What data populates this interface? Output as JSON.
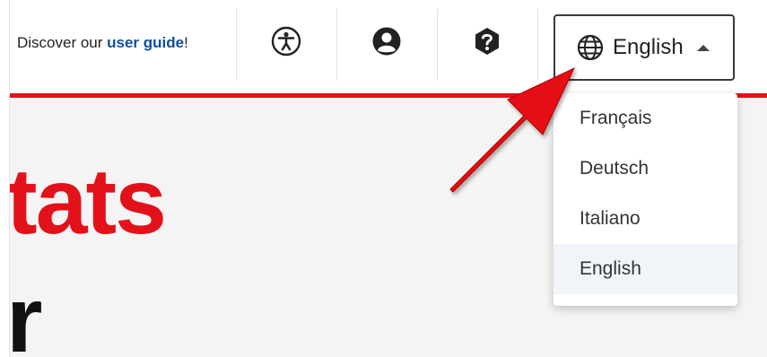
{
  "header": {
    "guide_prefix": "Discover our ",
    "guide_link": "user guide",
    "guide_suffix": "!"
  },
  "icons": {
    "accessibility": "accessibility-icon",
    "account": "user-account-icon",
    "help": "help-icon",
    "globe": "globe-icon",
    "caret": "caret-up-icon"
  },
  "language": {
    "current": "English",
    "options": [
      "Français",
      "Deutsch",
      "Italiano",
      "English"
    ],
    "selected_index": 3
  },
  "hero": {
    "line1": "tats",
    "line2": "r"
  },
  "colors": {
    "accent_red": "#e3121a",
    "link_blue": "#0b4fa3",
    "selected_bg": "#f1f5f9"
  }
}
